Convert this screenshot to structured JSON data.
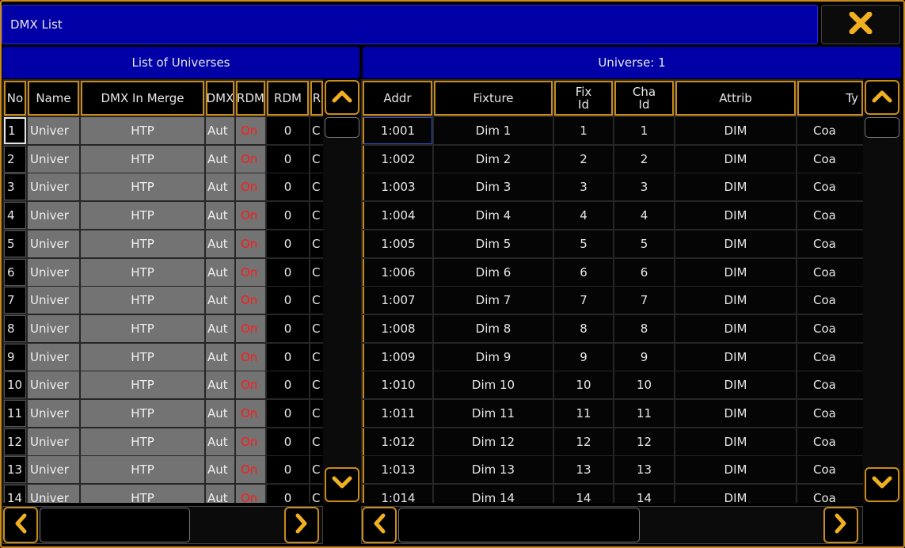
{
  "window": {
    "title": "DMX List"
  },
  "left": {
    "title": "List of Universes",
    "columns": {
      "no": "No",
      "name": "Name",
      "merge": "DMX In Merge",
      "dmx": "DMX",
      "rdm": "RDM",
      "rdmc": "RDM",
      "r": "R"
    },
    "rows": [
      {
        "no": "1",
        "name": "Univer",
        "merge": "HTP",
        "dmx": "Aut",
        "rdm": "On",
        "rdmc": "0",
        "r": "C"
      },
      {
        "no": "2",
        "name": "Univer",
        "merge": "HTP",
        "dmx": "Aut",
        "rdm": "On",
        "rdmc": "0",
        "r": "C"
      },
      {
        "no": "3",
        "name": "Univer",
        "merge": "HTP",
        "dmx": "Aut",
        "rdm": "On",
        "rdmc": "0",
        "r": "C"
      },
      {
        "no": "4",
        "name": "Univer",
        "merge": "HTP",
        "dmx": "Aut",
        "rdm": "On",
        "rdmc": "0",
        "r": "C"
      },
      {
        "no": "5",
        "name": "Univer",
        "merge": "HTP",
        "dmx": "Aut",
        "rdm": "On",
        "rdmc": "0",
        "r": "C"
      },
      {
        "no": "6",
        "name": "Univer",
        "merge": "HTP",
        "dmx": "Aut",
        "rdm": "On",
        "rdmc": "0",
        "r": "C"
      },
      {
        "no": "7",
        "name": "Univer",
        "merge": "HTP",
        "dmx": "Aut",
        "rdm": "On",
        "rdmc": "0",
        "r": "C"
      },
      {
        "no": "8",
        "name": "Univer",
        "merge": "HTP",
        "dmx": "Aut",
        "rdm": "On",
        "rdmc": "0",
        "r": "C"
      },
      {
        "no": "9",
        "name": "Univer",
        "merge": "HTP",
        "dmx": "Aut",
        "rdm": "On",
        "rdmc": "0",
        "r": "C"
      },
      {
        "no": "10",
        "name": "Univer",
        "merge": "HTP",
        "dmx": "Aut",
        "rdm": "On",
        "rdmc": "0",
        "r": "C"
      },
      {
        "no": "11",
        "name": "Univer",
        "merge": "HTP",
        "dmx": "Aut",
        "rdm": "On",
        "rdmc": "0",
        "r": "C"
      },
      {
        "no": "12",
        "name": "Univer",
        "merge": "HTP",
        "dmx": "Aut",
        "rdm": "On",
        "rdmc": "0",
        "r": "C"
      },
      {
        "no": "13",
        "name": "Univer",
        "merge": "HTP",
        "dmx": "Aut",
        "rdm": "On",
        "rdmc": "0",
        "r": "C"
      },
      {
        "no": "14",
        "name": "Univer",
        "merge": "HTP",
        "dmx": "Aut",
        "rdm": "On",
        "rdmc": "0",
        "r": "C"
      }
    ]
  },
  "right": {
    "title": "Universe: 1",
    "columns": {
      "addr": "Addr",
      "fixture": "Fixture",
      "fixid": "Fix\nId",
      "chaid": "Cha\nId",
      "attrib": "Attrib",
      "ty": "Ty"
    },
    "rows": [
      {
        "addr": "1:001",
        "fixture": "Dim 1",
        "fixid": "1",
        "chaid": "1",
        "attrib": "DIM",
        "ty": "Coa"
      },
      {
        "addr": "1:002",
        "fixture": "Dim 2",
        "fixid": "2",
        "chaid": "2",
        "attrib": "DIM",
        "ty": "Coa"
      },
      {
        "addr": "1:003",
        "fixture": "Dim 3",
        "fixid": "3",
        "chaid": "3",
        "attrib": "DIM",
        "ty": "Coa"
      },
      {
        "addr": "1:004",
        "fixture": "Dim 4",
        "fixid": "4",
        "chaid": "4",
        "attrib": "DIM",
        "ty": "Coa"
      },
      {
        "addr": "1:005",
        "fixture": "Dim 5",
        "fixid": "5",
        "chaid": "5",
        "attrib": "DIM",
        "ty": "Coa"
      },
      {
        "addr": "1:006",
        "fixture": "Dim 6",
        "fixid": "6",
        "chaid": "6",
        "attrib": "DIM",
        "ty": "Coa"
      },
      {
        "addr": "1:007",
        "fixture": "Dim 7",
        "fixid": "7",
        "chaid": "7",
        "attrib": "DIM",
        "ty": "Coa"
      },
      {
        "addr": "1:008",
        "fixture": "Dim 8",
        "fixid": "8",
        "chaid": "8",
        "attrib": "DIM",
        "ty": "Coa"
      },
      {
        "addr": "1:009",
        "fixture": "Dim 9",
        "fixid": "9",
        "chaid": "9",
        "attrib": "DIM",
        "ty": "Coa"
      },
      {
        "addr": "1:010",
        "fixture": "Dim 10",
        "fixid": "10",
        "chaid": "10",
        "attrib": "DIM",
        "ty": "Coa"
      },
      {
        "addr": "1:011",
        "fixture": "Dim 11",
        "fixid": "11",
        "chaid": "11",
        "attrib": "DIM",
        "ty": "Coa"
      },
      {
        "addr": "1:012",
        "fixture": "Dim 12",
        "fixid": "12",
        "chaid": "12",
        "attrib": "DIM",
        "ty": "Coa"
      },
      {
        "addr": "1:013",
        "fixture": "Dim 13",
        "fixid": "13",
        "chaid": "13",
        "attrib": "DIM",
        "ty": "Coa"
      },
      {
        "addr": "1:014",
        "fixture": "Dim 14",
        "fixid": "14",
        "chaid": "14",
        "attrib": "DIM",
        "ty": "Coa"
      }
    ]
  },
  "icons": {
    "close": "close-icon",
    "scroll_up": "chevron-up-icon",
    "scroll_down": "chevron-down-icon",
    "scroll_left": "chevron-left-icon",
    "scroll_right": "chevron-right-icon"
  },
  "colors": {
    "accent": "#c98a1a",
    "title_bg": "#0000a6",
    "gray_cell": "#737373",
    "rdm_on": "#ff1a1a",
    "close_x": "#f0b020"
  }
}
